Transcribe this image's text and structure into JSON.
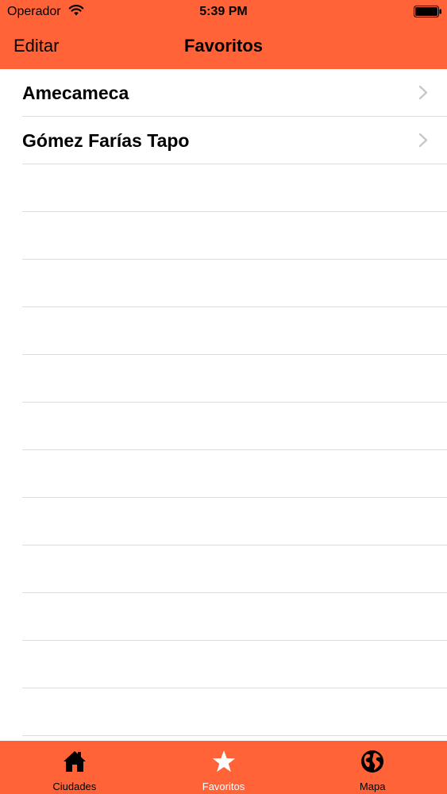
{
  "status_bar": {
    "carrier": "Operador",
    "time": "5:39 PM",
    "wifi_icon": "wifi-icon",
    "battery_icon": "battery-icon"
  },
  "nav_bar": {
    "edit_label": "Editar",
    "title": "Favoritos"
  },
  "favorites": [
    {
      "label": "Amecameca",
      "icon": "chevron-right-icon"
    },
    {
      "label": "Gómez Farías Tapo",
      "icon": "chevron-right-icon"
    }
  ],
  "tab_bar": {
    "tabs": [
      {
        "label": "Ciudades",
        "icon": "house-icon",
        "active": false
      },
      {
        "label": "Favoritos",
        "icon": "star-icon",
        "active": true
      },
      {
        "label": "Mapa",
        "icon": "globe-icon",
        "active": false
      }
    ]
  },
  "colors": {
    "accent": "#FF6337",
    "active_tab": "#FFFFFF",
    "inactive_tab": "#000000",
    "separator": "#DCDCDC"
  }
}
